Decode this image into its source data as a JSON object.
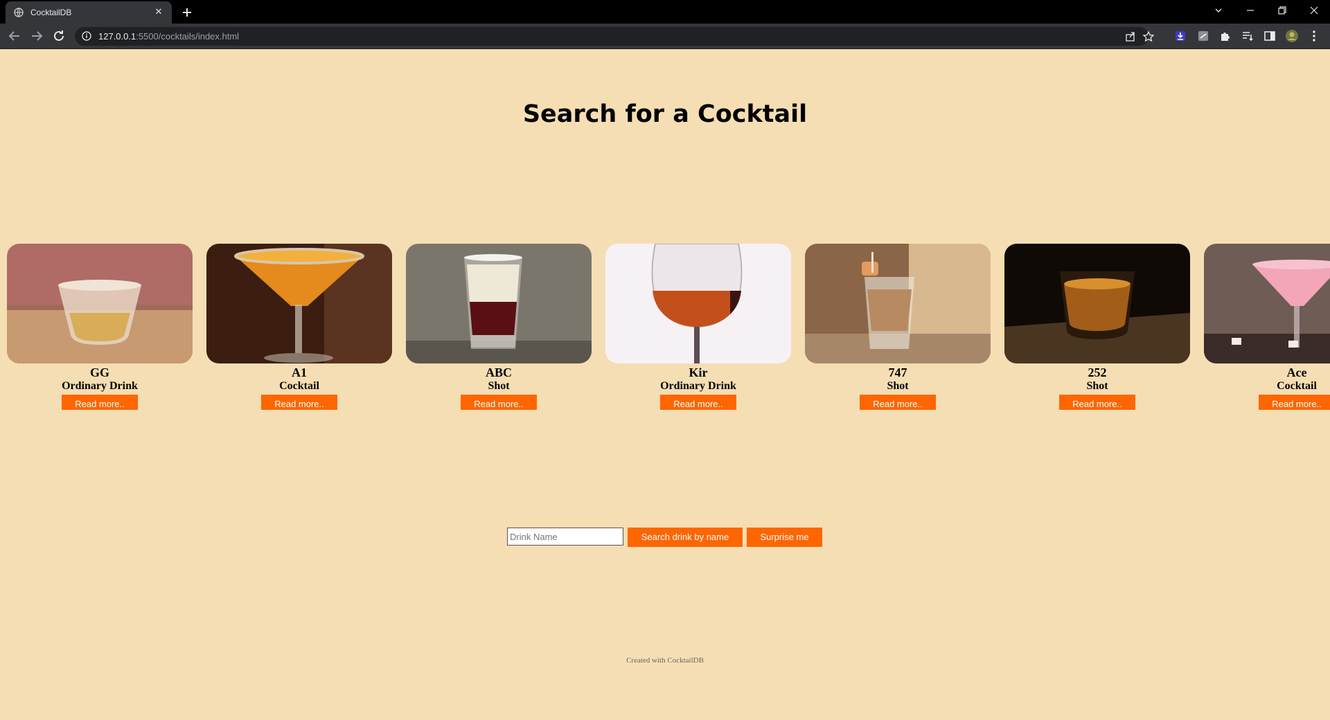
{
  "browser": {
    "tab_title": "CocktailDB",
    "url_host": "127.0.0.1",
    "url_path": ":5500/cocktails/index.html"
  },
  "page": {
    "heading": "Search for a Cocktail",
    "cocktails": [
      {
        "name": "GG",
        "category": "Ordinary Drink",
        "button": "Read more.."
      },
      {
        "name": "A1",
        "category": "Cocktail",
        "button": "Read more.."
      },
      {
        "name": "ABC",
        "category": "Shot",
        "button": "Read more.."
      },
      {
        "name": "Kir",
        "category": "Ordinary Drink",
        "button": "Read more.."
      },
      {
        "name": "747",
        "category": "Shot",
        "button": "Read more.."
      },
      {
        "name": "252",
        "category": "Shot",
        "button": "Read more.."
      },
      {
        "name": "Ace",
        "category": "Cocktail",
        "button": "Read more.."
      }
    ],
    "search": {
      "placeholder": "Drink Name",
      "value": "",
      "search_button": "Search drink by name",
      "surprise_button": "Surprise me"
    },
    "footer": "Created with CocktailDB"
  },
  "colors": {
    "background": "#f5deb3",
    "accent": "#ff6600"
  }
}
